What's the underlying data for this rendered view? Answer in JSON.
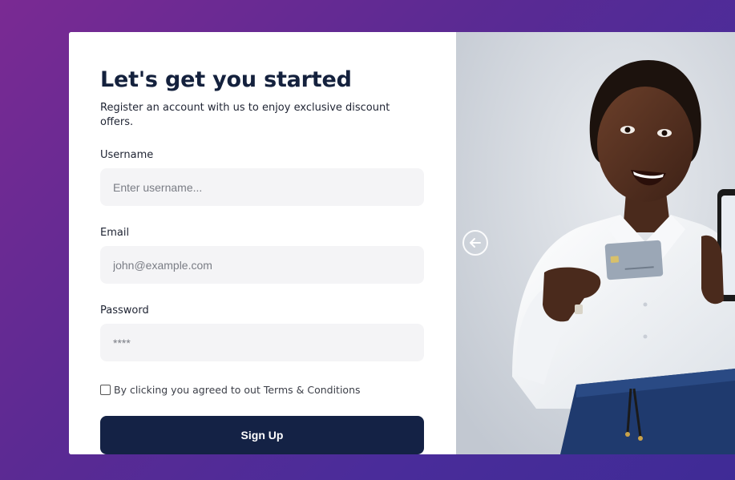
{
  "form": {
    "title": "Let's get you started",
    "subtitle": "Register an account with us to enjoy exclusive discount offers.",
    "fields": [
      {
        "label": "Username",
        "placeholder": "Enter username...",
        "value": ""
      },
      {
        "label": "Email",
        "placeholder": "john@example.com",
        "value": ""
      },
      {
        "label": "Password",
        "placeholder": "****",
        "value": ""
      }
    ],
    "terms_text": "By clicking you agreed to out Terms & Conditions",
    "terms_checked": false,
    "submit_label": "Sign Up"
  },
  "carousel": {
    "prev_icon": "arrow-left-circle-icon",
    "image": "smiling woman holding credit card and smartphone"
  },
  "colors": {
    "primary": "#142245",
    "title": "#14213d",
    "input_bg": "#f4f4f6",
    "background_gradient_start": "#7a2a93",
    "background_gradient_end": "#3f2b96"
  }
}
